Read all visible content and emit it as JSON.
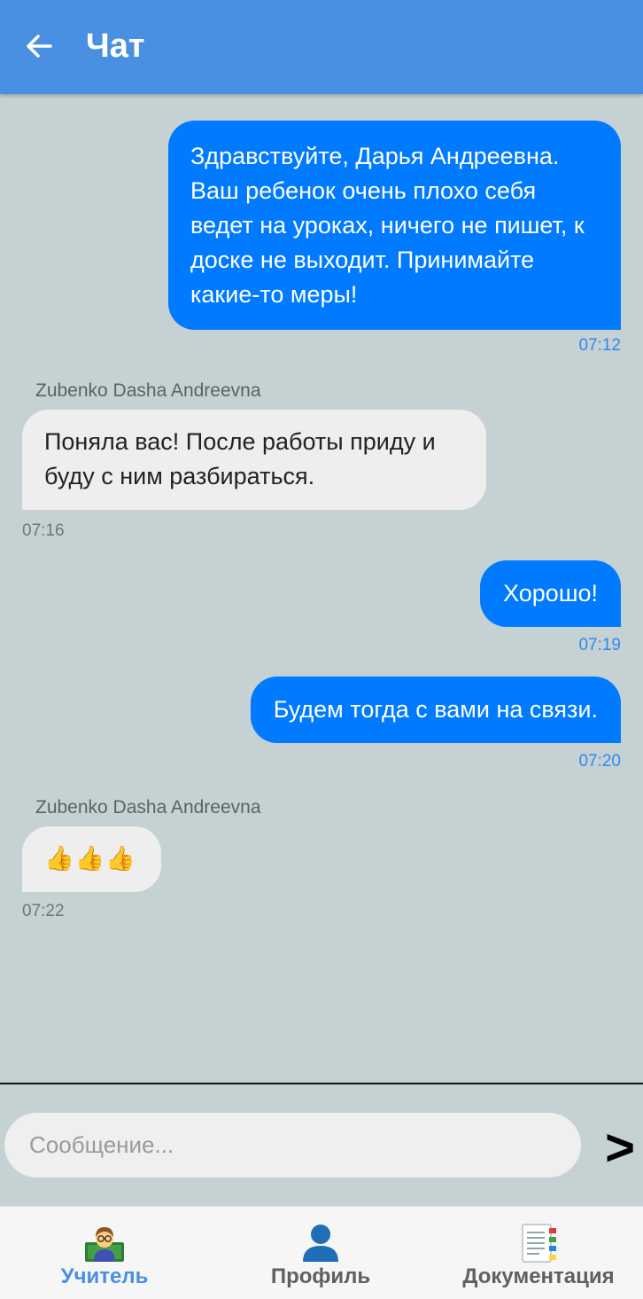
{
  "header": {
    "title": "Чат",
    "back_icon": "arrow-left-icon"
  },
  "messages": [
    {
      "direction": "outgoing",
      "text": "Здравствуйте, Дарья Андреевна. Ваш ребенок очень плохо себя ведет на уроках, ничего не пишет, к доске не выходит. Принимайте какие-то меры!",
      "time": "07:12"
    },
    {
      "direction": "incoming",
      "sender": "Zubenko Dasha Andreevna",
      "text": "Поняла вас! После работы приду и буду с ним разбираться.",
      "time": "07:16"
    },
    {
      "direction": "outgoing",
      "text": "Хорошо!",
      "time": "07:19"
    },
    {
      "direction": "outgoing",
      "text": "Будем тогда с вами на связи.",
      "time": "07:20"
    },
    {
      "direction": "incoming",
      "sender": "Zubenko Dasha Andreevna",
      "text": "👍👍👍",
      "time": "07:22"
    }
  ],
  "composer": {
    "placeholder": "Сообщение...",
    "value": "",
    "send_label": ">"
  },
  "tabs": [
    {
      "label": "Учитель",
      "icon": "teacher-icon",
      "active": true
    },
    {
      "label": "Профиль",
      "icon": "profile-icon",
      "active": false
    },
    {
      "label": "Документация",
      "icon": "document-icon",
      "active": false
    }
  ],
  "colors": {
    "appbar": "#4a90e2",
    "outgoing_bubble": "#007aff",
    "incoming_bubble": "#eeeeee",
    "chat_background": "#c5d1d2",
    "outgoing_time": "#2d8cf0",
    "active_tab": "#4a90e2"
  }
}
